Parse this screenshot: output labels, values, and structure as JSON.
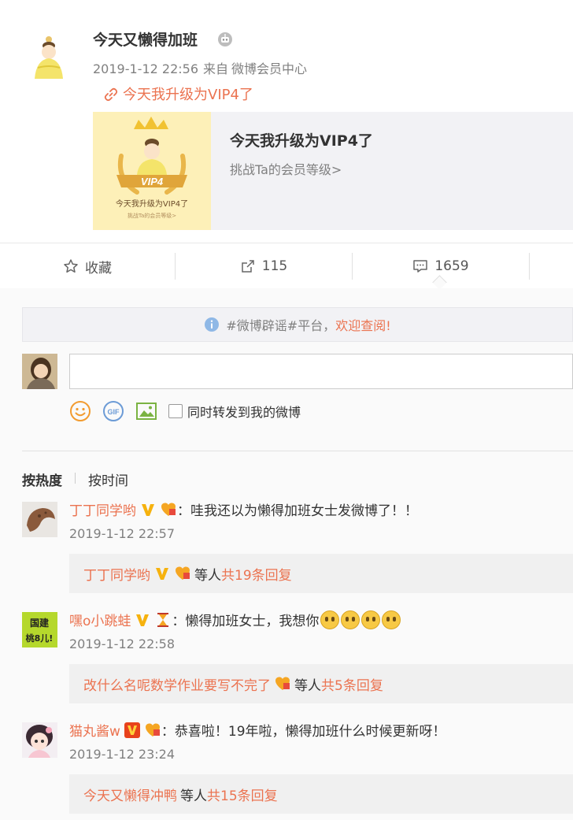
{
  "post": {
    "author": "今天又懒得加班",
    "time": "2019-1-12 22:56",
    "source_prefix": "来自",
    "source": "微博会员中心",
    "text_link": "今天我升级为VIP4了"
  },
  "card": {
    "title": "今天我升级为VIP4了",
    "subtitle": "挑战Ta的会员等级>",
    "thumb_badge": "VIP4",
    "thumb_caption": "今天我升级为VIP4了",
    "thumb_subcaption": "挑战Ta的会员等级>"
  },
  "actions": {
    "favorite": "收藏",
    "repost_count": "115",
    "comment_count": "1659"
  },
  "notice": {
    "prefix": "#微博辟谣#平台，",
    "link": "欢迎查阅!"
  },
  "composer": {
    "input_value": "",
    "forward_label": "同时转发到我的微博"
  },
  "sort": {
    "hot": "按热度",
    "time": "按时间"
  },
  "comments": [
    {
      "user": "丁丁同学哟",
      "text": "：哇我还以为懒得加班女士发微博了！！",
      "time": "2019-1-12 22:57",
      "reply_user": "丁丁同学哟",
      "reply_mid": "等人",
      "reply_count": "共19条回复"
    },
    {
      "user": "嘿o小跳蛙",
      "text": "：懒得加班女士，我想你",
      "time": "2019-1-12 22:58",
      "reply_user": "改什么名呢数学作业要写不完了",
      "reply_mid": "等人",
      "reply_count": "共5条回复",
      "avatar_text_top": "国建",
      "avatar_text_bottom": "桃8儿!"
    },
    {
      "user": "猫丸酱w",
      "text": "：恭喜啦！19年啦，懒得加班什么时候更新呀！",
      "time": "2019-1-12 23:24",
      "reply_user": "今天又懒得冲鸭",
      "reply_mid": "等人",
      "reply_count": "共15条回复"
    }
  ],
  "colors": {
    "accent": "#eb7350",
    "meta_gray": "#808080",
    "card_bg": "#f2f2f5",
    "reply_bg": "#f0f0f0"
  },
  "icons": [
    "robot-icon",
    "link-icon",
    "star-icon",
    "share-icon",
    "comment-icon",
    "info-icon",
    "smile-icon",
    "gif-icon",
    "image-icon",
    "vip-v-icon",
    "member-badge-icon",
    "hourglass-icon",
    "crying-emoji-icon"
  ]
}
